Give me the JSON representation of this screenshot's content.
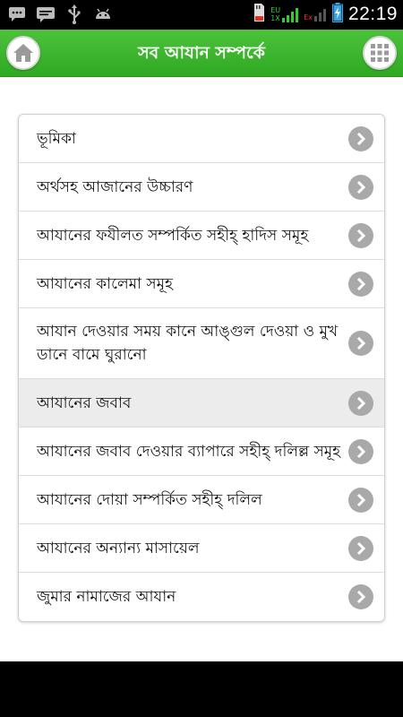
{
  "status_bar": {
    "time": "22:19",
    "left_icons": [
      "chat-bubble-icon",
      "message-icon",
      "usb-icon",
      "android-icon"
    ],
    "right_icons": [
      "sd-card-icon",
      "signal-eu-icon",
      "signal-ex-icon",
      "battery-charging-icon"
    ],
    "sim1_label_top": "EU",
    "sim1_label_bottom": "1X",
    "sim2_label": "Ex"
  },
  "header": {
    "title": "সব আযান সম্পর্কে",
    "home_icon": "home-icon",
    "grid_icon": "grid-menu-icon",
    "accent_color": "#39b52b"
  },
  "menu": {
    "items": [
      {
        "label": "ভূমিকা"
      },
      {
        "label": "অর্থসহ আজানের উচ্চারণ"
      },
      {
        "label": "আযানের ফযীলত সম্পর্কিত সহীহ্ হাদিস সমূহ"
      },
      {
        "label": "আযানের কালেমা সমূহ"
      },
      {
        "label": "আযান দেওয়ার সময় কানে আঙ্গুল দেওয়া ও মুখ ডানে বামে ঘুরানো"
      },
      {
        "label": "আযানের জবাব"
      },
      {
        "label": "আযানের জবাব দেওয়ার ব্যাপারে সহীহ্ দলিল্ল সমূহ"
      },
      {
        "label": "আযানের দোয়া সম্পর্কিত সহীহ্ দলিল"
      },
      {
        "label": "আযানের অন্যান্য মাসায়েল"
      },
      {
        "label": "জুমার নামাজের আযান"
      }
    ]
  }
}
